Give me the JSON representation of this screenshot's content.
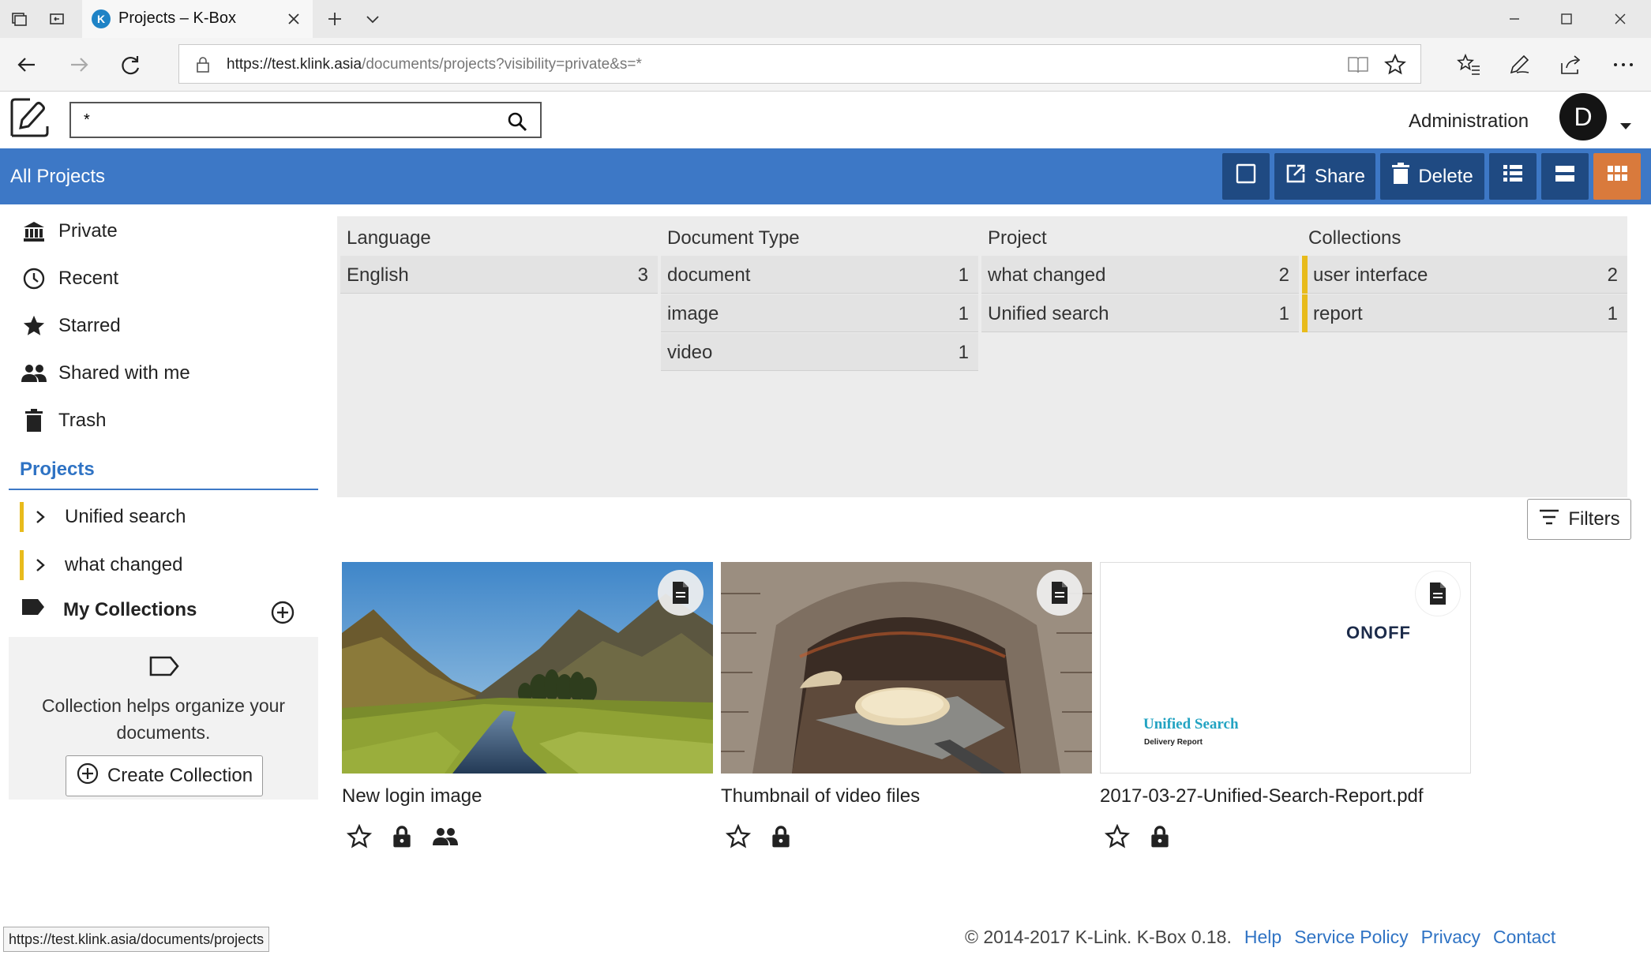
{
  "browser": {
    "tab_title": "Projects – K-Box",
    "url_host": "https://test.klink.asia",
    "url_path": "/documents/projects?visibility=private&s=*"
  },
  "header": {
    "search_value": "*",
    "admin_label": "Administration",
    "avatar_initial": "D"
  },
  "toolbar": {
    "title": "All Projects",
    "share_label": "Share",
    "delete_label": "Delete",
    "accent_color": "#3d78c6",
    "active_view_color": "#d97a3c"
  },
  "sidebar": {
    "items": [
      {
        "label": "Private",
        "icon": "bank-icon"
      },
      {
        "label": "Recent",
        "icon": "clock-icon"
      },
      {
        "label": "Starred",
        "icon": "star-icon"
      },
      {
        "label": "Shared with me",
        "icon": "people-icon"
      },
      {
        "label": "Trash",
        "icon": "trash-icon"
      }
    ],
    "projects_heading": "Projects",
    "projects": [
      {
        "label": "Unified search"
      },
      {
        "label": "what changed"
      }
    ],
    "collections_heading": "My Collections",
    "collections_help": "Collection helps organize your documents.",
    "create_collection_label": "Create Collection"
  },
  "facets": [
    {
      "heading": "Language",
      "rows": [
        {
          "label": "English",
          "count": "3"
        }
      ]
    },
    {
      "heading": "Document Type",
      "rows": [
        {
          "label": "document",
          "count": "1"
        },
        {
          "label": "image",
          "count": "1"
        },
        {
          "label": "video",
          "count": "1"
        }
      ]
    },
    {
      "heading": "Project",
      "rows": [
        {
          "label": "what changed",
          "count": "2"
        },
        {
          "label": "Unified search",
          "count": "1"
        }
      ]
    },
    {
      "heading": "Collections",
      "rows": [
        {
          "label": "user interface",
          "count": "2"
        },
        {
          "label": "report",
          "count": "1"
        }
      ]
    }
  ],
  "filters_label": "Filters",
  "documents": [
    {
      "title": "New login image",
      "shared": true
    },
    {
      "title": "Thumbnail of video files",
      "shared": false
    },
    {
      "title": "2017-03-27-Unified-Search-Report.pdf",
      "shared": false,
      "thumb_logo": "ONOFF",
      "thumb_heading": "Unified Search",
      "thumb_sub": "Delivery Report"
    }
  ],
  "footer": {
    "copyright": "© 2014-2017 K-Link. K-Box 0.18.",
    "links": [
      "Help",
      "Service Policy",
      "Privacy",
      "Contact"
    ]
  },
  "status_url": "https://test.klink.asia/documents/projects"
}
